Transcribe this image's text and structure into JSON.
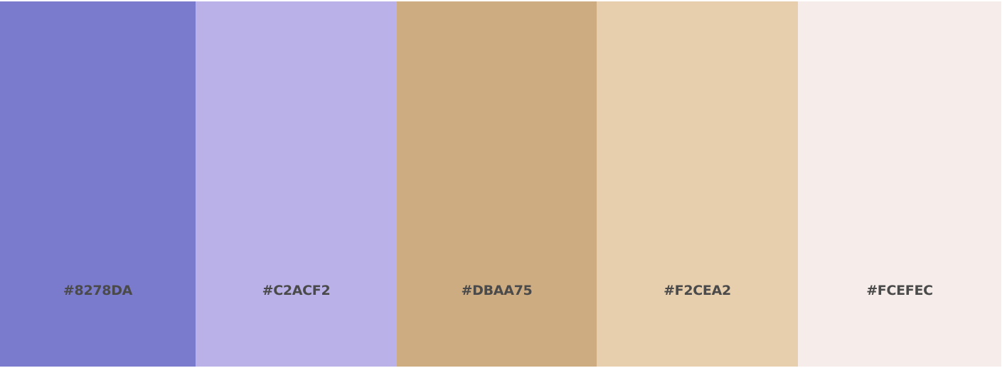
{
  "palette": {
    "swatches": [
      {
        "hex_label": "#8278DA",
        "display_color": "#7B7BCE"
      },
      {
        "hex_label": "#C2ACF2",
        "display_color": "#B9B1E8"
      },
      {
        "hex_label": "#DBAA75",
        "display_color": "#CDAC82"
      },
      {
        "hex_label": "#F2CEA2",
        "display_color": "#E7CFAE"
      },
      {
        "hex_label": "#FCEFEC",
        "display_color": "#F6EDEA"
      }
    ]
  }
}
